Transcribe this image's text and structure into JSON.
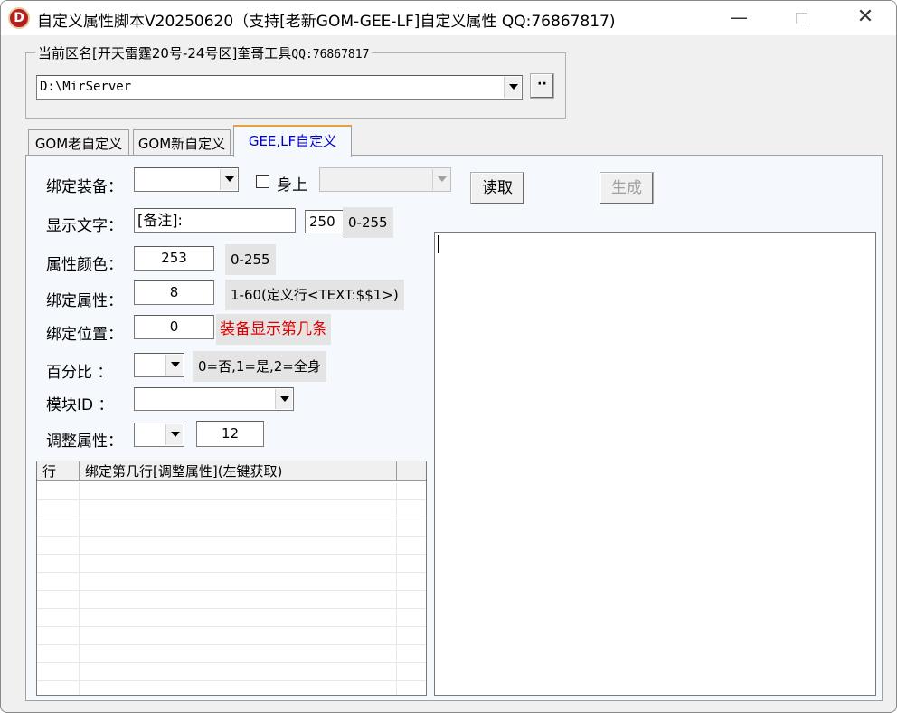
{
  "window": {
    "title": "自定义属性脚本V20250620（支持[老新GOM-GEE-LF]自定义属性 QQ:76867817)",
    "icon_letter": "D",
    "minimize_glyph": "—",
    "close_glyph": "✕"
  },
  "region_group": {
    "legend_prefix": "当前区名[开天雷霆20号-24号区]奎哥工具",
    "legend_qq": "QQ:76867817",
    "path_value": "D:\\MirServer",
    "browse_label": "··"
  },
  "tabs": [
    {
      "label": "GOM老自定义",
      "active": false
    },
    {
      "label": "GOM新自定义",
      "active": false
    },
    {
      "label": "GEE,LF自定义",
      "active": true
    }
  ],
  "form": {
    "bind_equip_label": "绑定装备：",
    "bind_equip_value": "",
    "on_body_label": "身上",
    "on_body_checked": false,
    "body_select_value": "",
    "read_button": "读取",
    "generate_button": "生成",
    "display_text_label": "显示文字：",
    "display_text_value": "[备注]:",
    "display_num_value": "250",
    "display_range_hint": "0-255",
    "attr_color_label": "属性颜色：",
    "attr_color_value": "253",
    "attr_color_hint": "0-255",
    "bind_attr_label": "绑定属性：",
    "bind_attr_value": "8",
    "bind_attr_hint": "1-60(定义行<TEXT:$$1>)",
    "bind_pos_label": "绑定位置：",
    "bind_pos_value": "0",
    "bind_pos_hint": "装备显示第几条",
    "percent_label": "百分比  ：",
    "percent_value": "",
    "percent_hint": "0=否,1=是,2=全身",
    "module_label": "模块ID  ：",
    "module_value": "",
    "adjust_label": "调整属性：",
    "adjust_select_value": "",
    "adjust_num_value": "12"
  },
  "grid": {
    "headers": [
      "行",
      "绑定第几行[调整属性](左键获取)",
      ""
    ],
    "rows": []
  }
}
